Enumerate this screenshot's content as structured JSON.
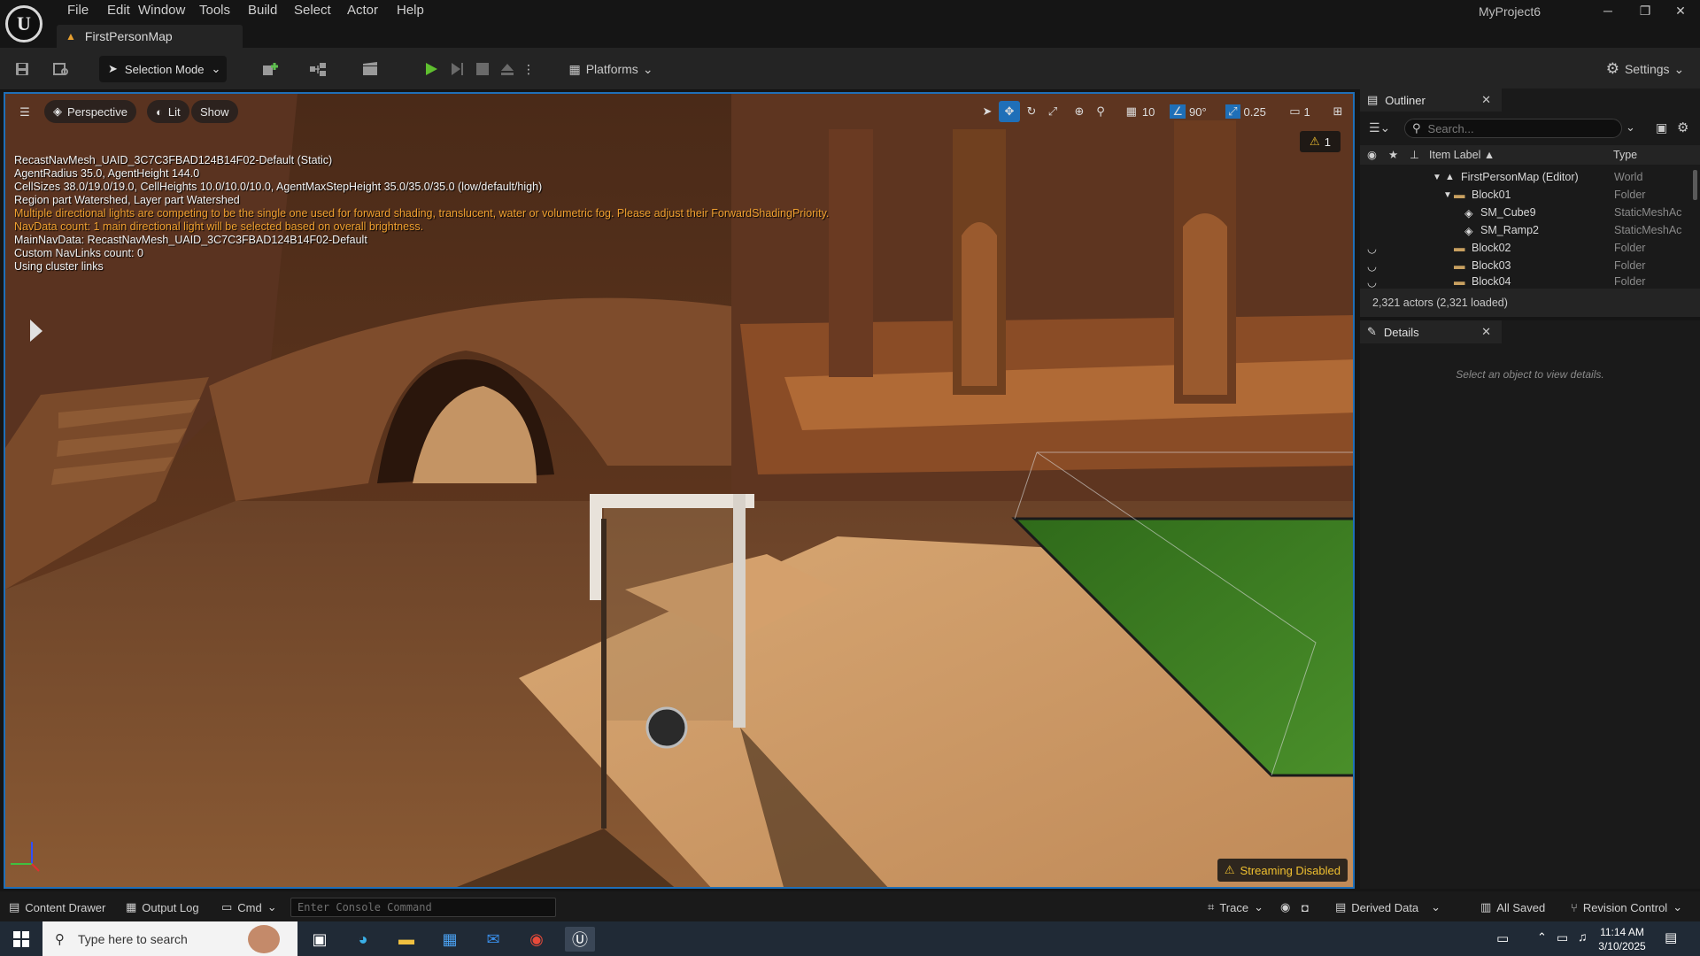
{
  "app": {
    "project_name": "MyProject6",
    "logo_text": "U"
  },
  "menu": [
    "File",
    "Edit",
    "Window",
    "Tools",
    "Build",
    "Select",
    "Actor",
    "Help"
  ],
  "map_tab": {
    "label": "FirstPersonMap"
  },
  "window_controls": {
    "minimize": "─",
    "restore": "❐",
    "close": "✕"
  },
  "toolbar": {
    "selection_mode": "Selection Mode",
    "platforms": "Platforms",
    "settings": "Settings"
  },
  "viewport": {
    "perspective": "Perspective",
    "lit": "Lit",
    "show": "Show",
    "grid_size": "10",
    "rotation_snap": "90°",
    "scale_snap": "0.25",
    "camera_speed": "1",
    "warning_count": "1",
    "stats": [
      {
        "text": "RecastNavMesh_UAID_3C7C3FBAD124B14F02-Default (Static)",
        "warn": false
      },
      {
        "text": "AgentRadius 35.0, AgentHeight 144.0",
        "warn": false
      },
      {
        "text": "CellSizes 38.0/19.0/19.0, CellHeights 10.0/10.0/10.0, AgentMaxStepHeight 35.0/35.0/35.0 (low/default/high)",
        "warn": false
      },
      {
        "text": "Region part Watershed, Layer part Watershed",
        "warn": false
      },
      {
        "text": "Multiple directional lights are competing to be the single one used for forward shading, translucent, water or volumetric fog. Please adjust their ForwardShadingPriority.",
        "warn": true
      },
      {
        "text": "NavData count: 1   main directional light will be selected based on overall brightness.",
        "warn": true
      },
      {
        "text": "MainNavData: RecastNavMesh_UAID_3C7C3FBAD124B14F02-Default",
        "warn": false
      },
      {
        "text": "Custom NavLinks count: 0",
        "warn": false
      },
      {
        "text": "Using cluster links",
        "warn": false
      }
    ],
    "streaming": "Streaming Disabled"
  },
  "outliner": {
    "title": "Outliner",
    "search_placeholder": "Search...",
    "col_label": "Item Label ▲",
    "col_type": "Type",
    "rows": [
      {
        "label": "FirstPersonMap (Editor)",
        "type": "World"
      },
      {
        "label": "Block01",
        "type": "Folder"
      },
      {
        "label": "SM_Cube9",
        "type": "StaticMeshAc"
      },
      {
        "label": "SM_Ramp2",
        "type": "StaticMeshAc"
      },
      {
        "label": "Block02",
        "type": "Folder"
      },
      {
        "label": "Block03",
        "type": "Folder"
      },
      {
        "label": "Block04",
        "type": "Folder"
      }
    ],
    "actor_count": "2,321 actors (2,321 loaded)"
  },
  "details": {
    "title": "Details",
    "empty_text": "Select an object to view details."
  },
  "statusbar": {
    "content_drawer": "Content Drawer",
    "output_log": "Output Log",
    "cmd": "Cmd",
    "console_placeholder": "Enter Console Command",
    "trace": "Trace",
    "derived_data": "Derived Data",
    "all_saved": "All Saved",
    "revision_control": "Revision Control"
  },
  "taskbar": {
    "search_placeholder": "Type here to search",
    "time": "11:14 AM",
    "date": "3/10/2025"
  }
}
